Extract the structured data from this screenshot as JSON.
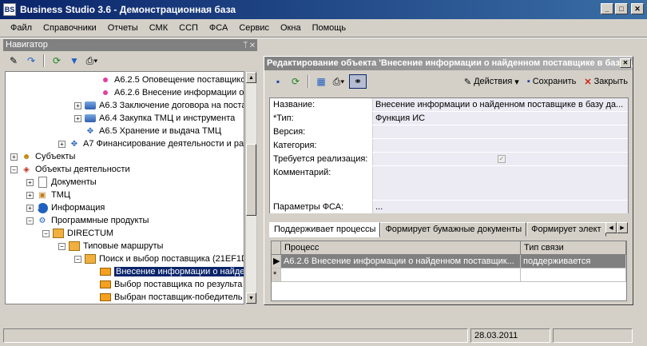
{
  "app": {
    "title": "Business Studio 3.6 - Демонстрационная база",
    "icon": "BS"
  },
  "menu": [
    "Файл",
    "Справочники",
    "Отчеты",
    "СМК",
    "ССП",
    "ФСА",
    "Сервис",
    "Окна",
    "Помощь"
  ],
  "navigator": {
    "title": "Навигатор",
    "tree": [
      "А6.2.5 Оповещение поставщико",
      "А6.2.6 Внесение информации о",
      "А6.3 Заключение договора на поста",
      "А6.4 Закупка ТМЦ и инструмента",
      "А6.5 Хранение и выдача ТМЦ",
      "А7 Финансирование деятельности и ра",
      "Субъекты",
      "Объекты деятельности",
      "Документы",
      "ТМЦ",
      "Информация",
      "Программные продукты",
      "DIRECTUM",
      "Типовые маршруты",
      "Поиск и выбор поставщика (21EF1D",
      "Внесение информации о найден",
      "Выбор поставщика по результа",
      "Выбран поставщик-победитель"
    ]
  },
  "editor": {
    "title": "Редактирование объекта 'Внесение информации о найденном поставщике в базу данных'",
    "actions_label": "Действия",
    "save_label": "Сохранить",
    "close_label": "Закрыть",
    "props": [
      {
        "name": "Название:",
        "value": "Внесение информации о найденном поставщике в базу да..."
      },
      {
        "name": "*Тип:",
        "value": "Функция ИС"
      },
      {
        "name": "Версия:",
        "value": ""
      },
      {
        "name": "Категория:",
        "value": ""
      },
      {
        "name": "Требуется реализация:",
        "value": ""
      },
      {
        "name": "Комментарий:",
        "value": ""
      },
      {
        "name": "Параметры ФСА:",
        "value": "..."
      }
    ],
    "tabs": [
      "Поддерживает процессы",
      "Формирует бумажные документы",
      "Формирует элект"
    ],
    "grid": {
      "columns": [
        "Процесс",
        "Тип связи"
      ],
      "rows": [
        {
          "process": "А6.2.6 Внесение информации о найденном поставщик...",
          "link_type": "поддерживается"
        }
      ],
      "new_row_marker": "*"
    }
  },
  "status": {
    "date": "28.03.2011"
  }
}
